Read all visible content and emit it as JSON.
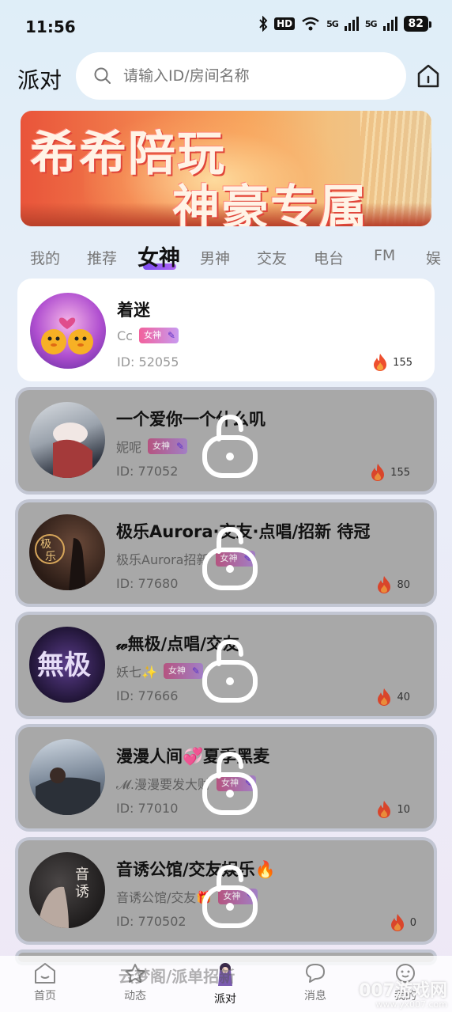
{
  "status_bar": {
    "time": "11:56",
    "hd": "HD",
    "network": "5G",
    "battery": "82"
  },
  "header": {
    "title": "派对",
    "search_placeholder": "请输入ID/房间名称"
  },
  "banner": {
    "line1": "希希陪玩",
    "line2": "神豪专属"
  },
  "tabs": [
    {
      "label": "我的",
      "active": false
    },
    {
      "label": "推荐",
      "active": false
    },
    {
      "label": "女神",
      "active": true
    },
    {
      "label": "男神",
      "active": false
    },
    {
      "label": "交友",
      "active": false
    },
    {
      "label": "电台",
      "active": false
    },
    {
      "label": "FM",
      "active": false
    },
    {
      "label": "娱",
      "active": false
    }
  ],
  "badge_label": "女神",
  "rooms": [
    {
      "title": "着迷",
      "host": "Cc",
      "id": "ID: 52055",
      "heat": "155",
      "locked": false
    },
    {
      "title": "一个爱你一个什么叽",
      "host": "妮呢",
      "id": "ID: 77052",
      "heat": "155",
      "locked": true
    },
    {
      "title": "极乐Aurora·交友·点唱/招新 待冠",
      "host": "极乐Aurora招新",
      "id": "ID: 77680",
      "heat": "80",
      "locked": true
    },
    {
      "title": "𝓌無极/点唱/交友",
      "host": "妖七✨",
      "id": "ID: 77666",
      "heat": "40",
      "locked": true
    },
    {
      "title": "漫漫人间💞夏季黑麦",
      "host": "𝓜.漫漫要发大财",
      "id": "ID: 77010",
      "heat": "10",
      "locked": true
    },
    {
      "title": "音诱公馆/交友娱乐🔥",
      "host": "音诱公馆/交友🎁",
      "id": "ID: 770502",
      "heat": "0",
      "locked": true
    }
  ],
  "peek_title": "云梦阁/派单招新",
  "bottom_nav": [
    {
      "label": "首页",
      "icon": "home-icon"
    },
    {
      "label": "动态",
      "icon": "star-icon"
    },
    {
      "label": "派对",
      "icon": "party-mascot-icon",
      "active": true
    },
    {
      "label": "消息",
      "icon": "message-icon"
    },
    {
      "label": "我的",
      "icon": "profile-icon"
    }
  ],
  "watermark": {
    "main": "007游戏网",
    "sub": "www.yx007.com"
  }
}
